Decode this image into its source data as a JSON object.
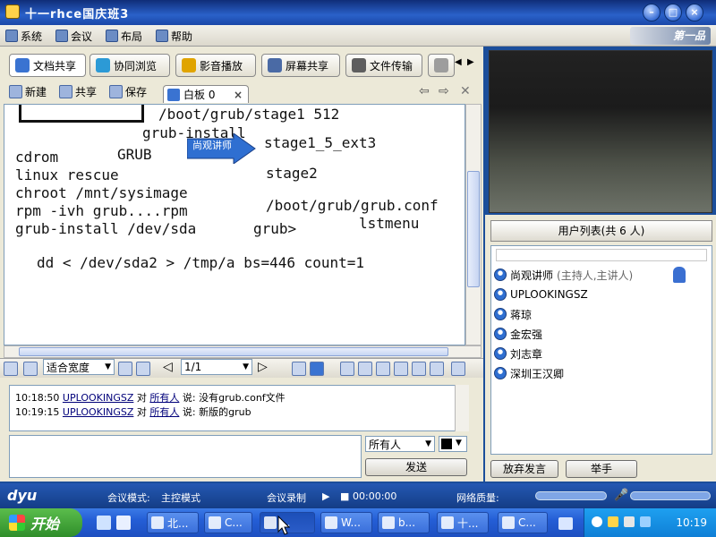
{
  "window": {
    "title": "十一rhce国庆班3"
  },
  "menu": {
    "items": [
      "系统",
      "会议",
      "布局",
      "帮助"
    ],
    "logo_text": "第一品"
  },
  "tabs": [
    "文档共享",
    "协同浏览",
    "影音播放",
    "屏幕共享",
    "文件传输"
  ],
  "doc_toolbar": {
    "new": "新建",
    "share": "共享",
    "save": "保存",
    "whiteboard_tab": "白板 0"
  },
  "whiteboard": {
    "lines": [
      "/boot/grub/stage1 512",
      "grub-install",
      "cdrom",
      "GRUB",
      "linux rescue",
      "chroot /mnt/sysimage",
      "rpm -ivh grub....rpm",
      "grub-install /dev/sda",
      "stage1_5_ext3",
      "stage2",
      "/boot/grub/grub.conf",
      "grub>",
      "lstmenu",
      "dd < /dev/sda2  > /tmp/a bs=446 count=1"
    ],
    "pointer_label": "尚观讲师"
  },
  "view_toolbar": {
    "fit": "适合宽度",
    "page": "1/1"
  },
  "chat": {
    "messages": [
      {
        "time": "10:18:50",
        "user": "UPLOOKINGSZ",
        "to": "对",
        "target": "所有人",
        "says": "说:",
        "text": "没有grub.conf文件"
      },
      {
        "time": "10:19:15",
        "user": "UPLOOKINGSZ",
        "to": "对",
        "target": "所有人",
        "says": "说:",
        "text": "新版的grub"
      }
    ],
    "recipient": "所有人",
    "send_label": "发送"
  },
  "userlist": {
    "title": "用户列表(共 6 人)",
    "users": [
      {
        "name": "尚观讲师",
        "note": "(主持人,主讲人)"
      },
      {
        "name": "UPLOOKINGSZ",
        "note": ""
      },
      {
        "name": "蒋琼",
        "note": ""
      },
      {
        "name": "金宏强",
        "note": ""
      },
      {
        "name": "刘志章",
        "note": ""
      },
      {
        "name": "深圳王汉卿",
        "note": ""
      }
    ],
    "give_up_label": "放弃发言",
    "raise_hand_label": "举手"
  },
  "status": {
    "brand": "dyu",
    "mode_label": "会议模式:",
    "mode_value": "主控模式",
    "record_label": "会议录制",
    "record_time": "00:00:00",
    "quality_label": "网络质量:"
  },
  "taskbar": {
    "start": "开始",
    "tasks": [
      "北...",
      "C...",
      "...",
      "W...",
      "b...",
      "十...",
      "C..."
    ],
    "clock": "10:19"
  }
}
